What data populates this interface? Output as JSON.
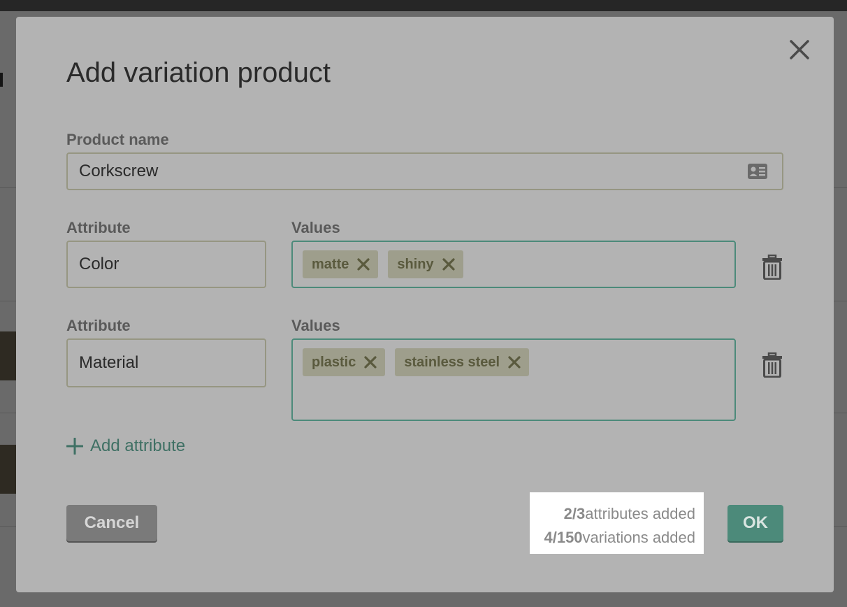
{
  "modal": {
    "title": "Add variation product",
    "product_name_label": "Product name",
    "product_name_value": "Corkscrew",
    "attributes": [
      {
        "attribute_label": "Attribute",
        "values_label": "Values",
        "name": "Color",
        "values": [
          "matte",
          "shiny"
        ]
      },
      {
        "attribute_label": "Attribute",
        "values_label": "Values",
        "name": "Material",
        "values": [
          "plastic",
          "stainless steel"
        ]
      }
    ],
    "add_attribute_label": "Add attribute",
    "cancel_label": "Cancel",
    "ok_label": "OK",
    "stats": {
      "attributes_count": "2/3",
      "attributes_text": "attributes added",
      "variations_count": "4/150",
      "variations_text": "variations added"
    }
  },
  "colors": {
    "overlay_modal": "#b3b3b3",
    "accent": "#4c8a7a",
    "tag_bg": "#9e9e8c",
    "cancel_bg": "#7a7a7a"
  },
  "icons": {
    "close": "close-icon",
    "contact_card": "contact-card-icon",
    "tag_remove": "remove-x-icon",
    "delete": "trash-icon",
    "add": "plus-icon"
  }
}
